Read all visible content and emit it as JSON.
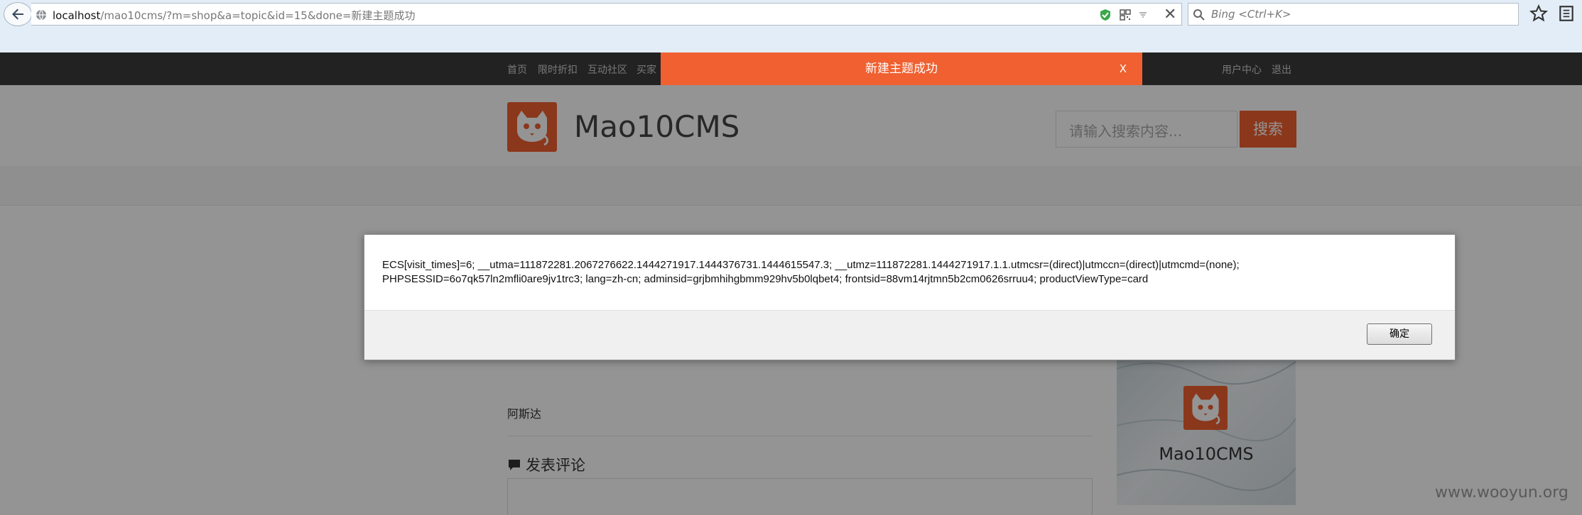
{
  "browser": {
    "url_host": "localhost",
    "url_path": "/mao10cms/?m=shop&a=topic&id=15&done=新建主题成功",
    "search_placeholder": "Bing <Ctrl+K>"
  },
  "topnav": {
    "items": [
      "首页",
      "限时折扣",
      "互动社区",
      "买家"
    ],
    "right_items": [
      "用户中心",
      "退出"
    ]
  },
  "flash": {
    "message": "新建主题成功",
    "close_label": "X"
  },
  "header": {
    "site_name": "Mao10CMS",
    "search_placeholder": "请输入搜索内容...",
    "search_button": "搜索"
  },
  "topic": {
    "author": "阿斯达",
    "comment_title": "发表评论"
  },
  "sidebar": {
    "image_caption": "Mao10CMS"
  },
  "dialog": {
    "line1": "ECS[visit_times]=6; __utma=111872281.2067276622.1444271917.1444376731.1444615547.3; __utmz=111872281.1444271917.1.1.utmcsr=(direct)|utmccn=(direct)|utmcmd=(none);",
    "line2": "PHPSESSID=6o7qk57ln2mfli0are9jv1trc3; lang=zh-cn; adminsid=grjbmhihgbmm929hv5b0lqbet4; frontsid=88vm14rjtmn5b2cm0626srruu4; productViewType=card",
    "ok_button": "确定"
  },
  "watermark": "www.wooyun.org",
  "colors": {
    "accent": "#f06030",
    "topnav_bg": "#3c3c3c",
    "chrome_bg": "#e3edf8"
  }
}
